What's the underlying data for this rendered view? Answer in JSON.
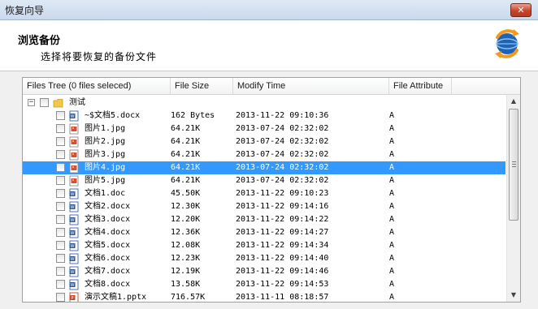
{
  "window": {
    "title": "恢复向导",
    "close_label": "✕"
  },
  "header": {
    "title": "浏览备份",
    "subtitle": "选择将要恢复的备份文件",
    "logo_icon": "restore-globe-icon"
  },
  "columns": [
    "Files Tree (0 files seleced)",
    "File Size",
    "Modify Time",
    "File Attribute"
  ],
  "tree": {
    "root_label": "测试",
    "root_expander": "−"
  },
  "files": [
    {
      "name": "~$文档5.docx",
      "size": "162 Bytes",
      "time": "2013-11-22 09:10:36",
      "attr": "A",
      "icon": "word"
    },
    {
      "name": "图片1.jpg",
      "size": "64.21K",
      "time": "2013-07-24 02:32:02",
      "attr": "A",
      "icon": "image"
    },
    {
      "name": "图片2.jpg",
      "size": "64.21K",
      "time": "2013-07-24 02:32:02",
      "attr": "A",
      "icon": "image"
    },
    {
      "name": "图片3.jpg",
      "size": "64.21K",
      "time": "2013-07-24 02:32:02",
      "attr": "A",
      "icon": "image"
    },
    {
      "name": "图片4.jpg",
      "size": "64.21K",
      "time": "2013-07-24 02:32:02",
      "attr": "A",
      "icon": "image",
      "selected": true
    },
    {
      "name": "图片5.jpg",
      "size": "64.21K",
      "time": "2013-07-24 02:32:02",
      "attr": "A",
      "icon": "image"
    },
    {
      "name": "文档1.doc",
      "size": "45.50K",
      "time": "2013-11-22 09:10:23",
      "attr": "A",
      "icon": "word"
    },
    {
      "name": "文档2.docx",
      "size": "12.30K",
      "time": "2013-11-22 09:14:16",
      "attr": "A",
      "icon": "word"
    },
    {
      "name": "文档3.docx",
      "size": "12.20K",
      "time": "2013-11-22 09:14:22",
      "attr": "A",
      "icon": "word"
    },
    {
      "name": "文档4.docx",
      "size": "12.36K",
      "time": "2013-11-22 09:14:27",
      "attr": "A",
      "icon": "word"
    },
    {
      "name": "文档5.docx",
      "size": "12.08K",
      "time": "2013-11-22 09:14:34",
      "attr": "A",
      "icon": "word"
    },
    {
      "name": "文档6.docx",
      "size": "12.23K",
      "time": "2013-11-22 09:14:40",
      "attr": "A",
      "icon": "word"
    },
    {
      "name": "文档7.docx",
      "size": "12.19K",
      "time": "2013-11-22 09:14:46",
      "attr": "A",
      "icon": "word"
    },
    {
      "name": "文档8.docx",
      "size": "13.58K",
      "time": "2013-11-22 09:14:53",
      "attr": "A",
      "icon": "word"
    },
    {
      "name": "演示文稿1.pptx",
      "size": "716.57K",
      "time": "2013-11-11 08:18:57",
      "attr": "A",
      "icon": "ppt"
    }
  ],
  "scrollbar": {
    "up": "▲",
    "down": "▼"
  },
  "colors": {
    "selection": "#3399ff",
    "close": "#c7442b",
    "header_bg": "#ffffff"
  }
}
